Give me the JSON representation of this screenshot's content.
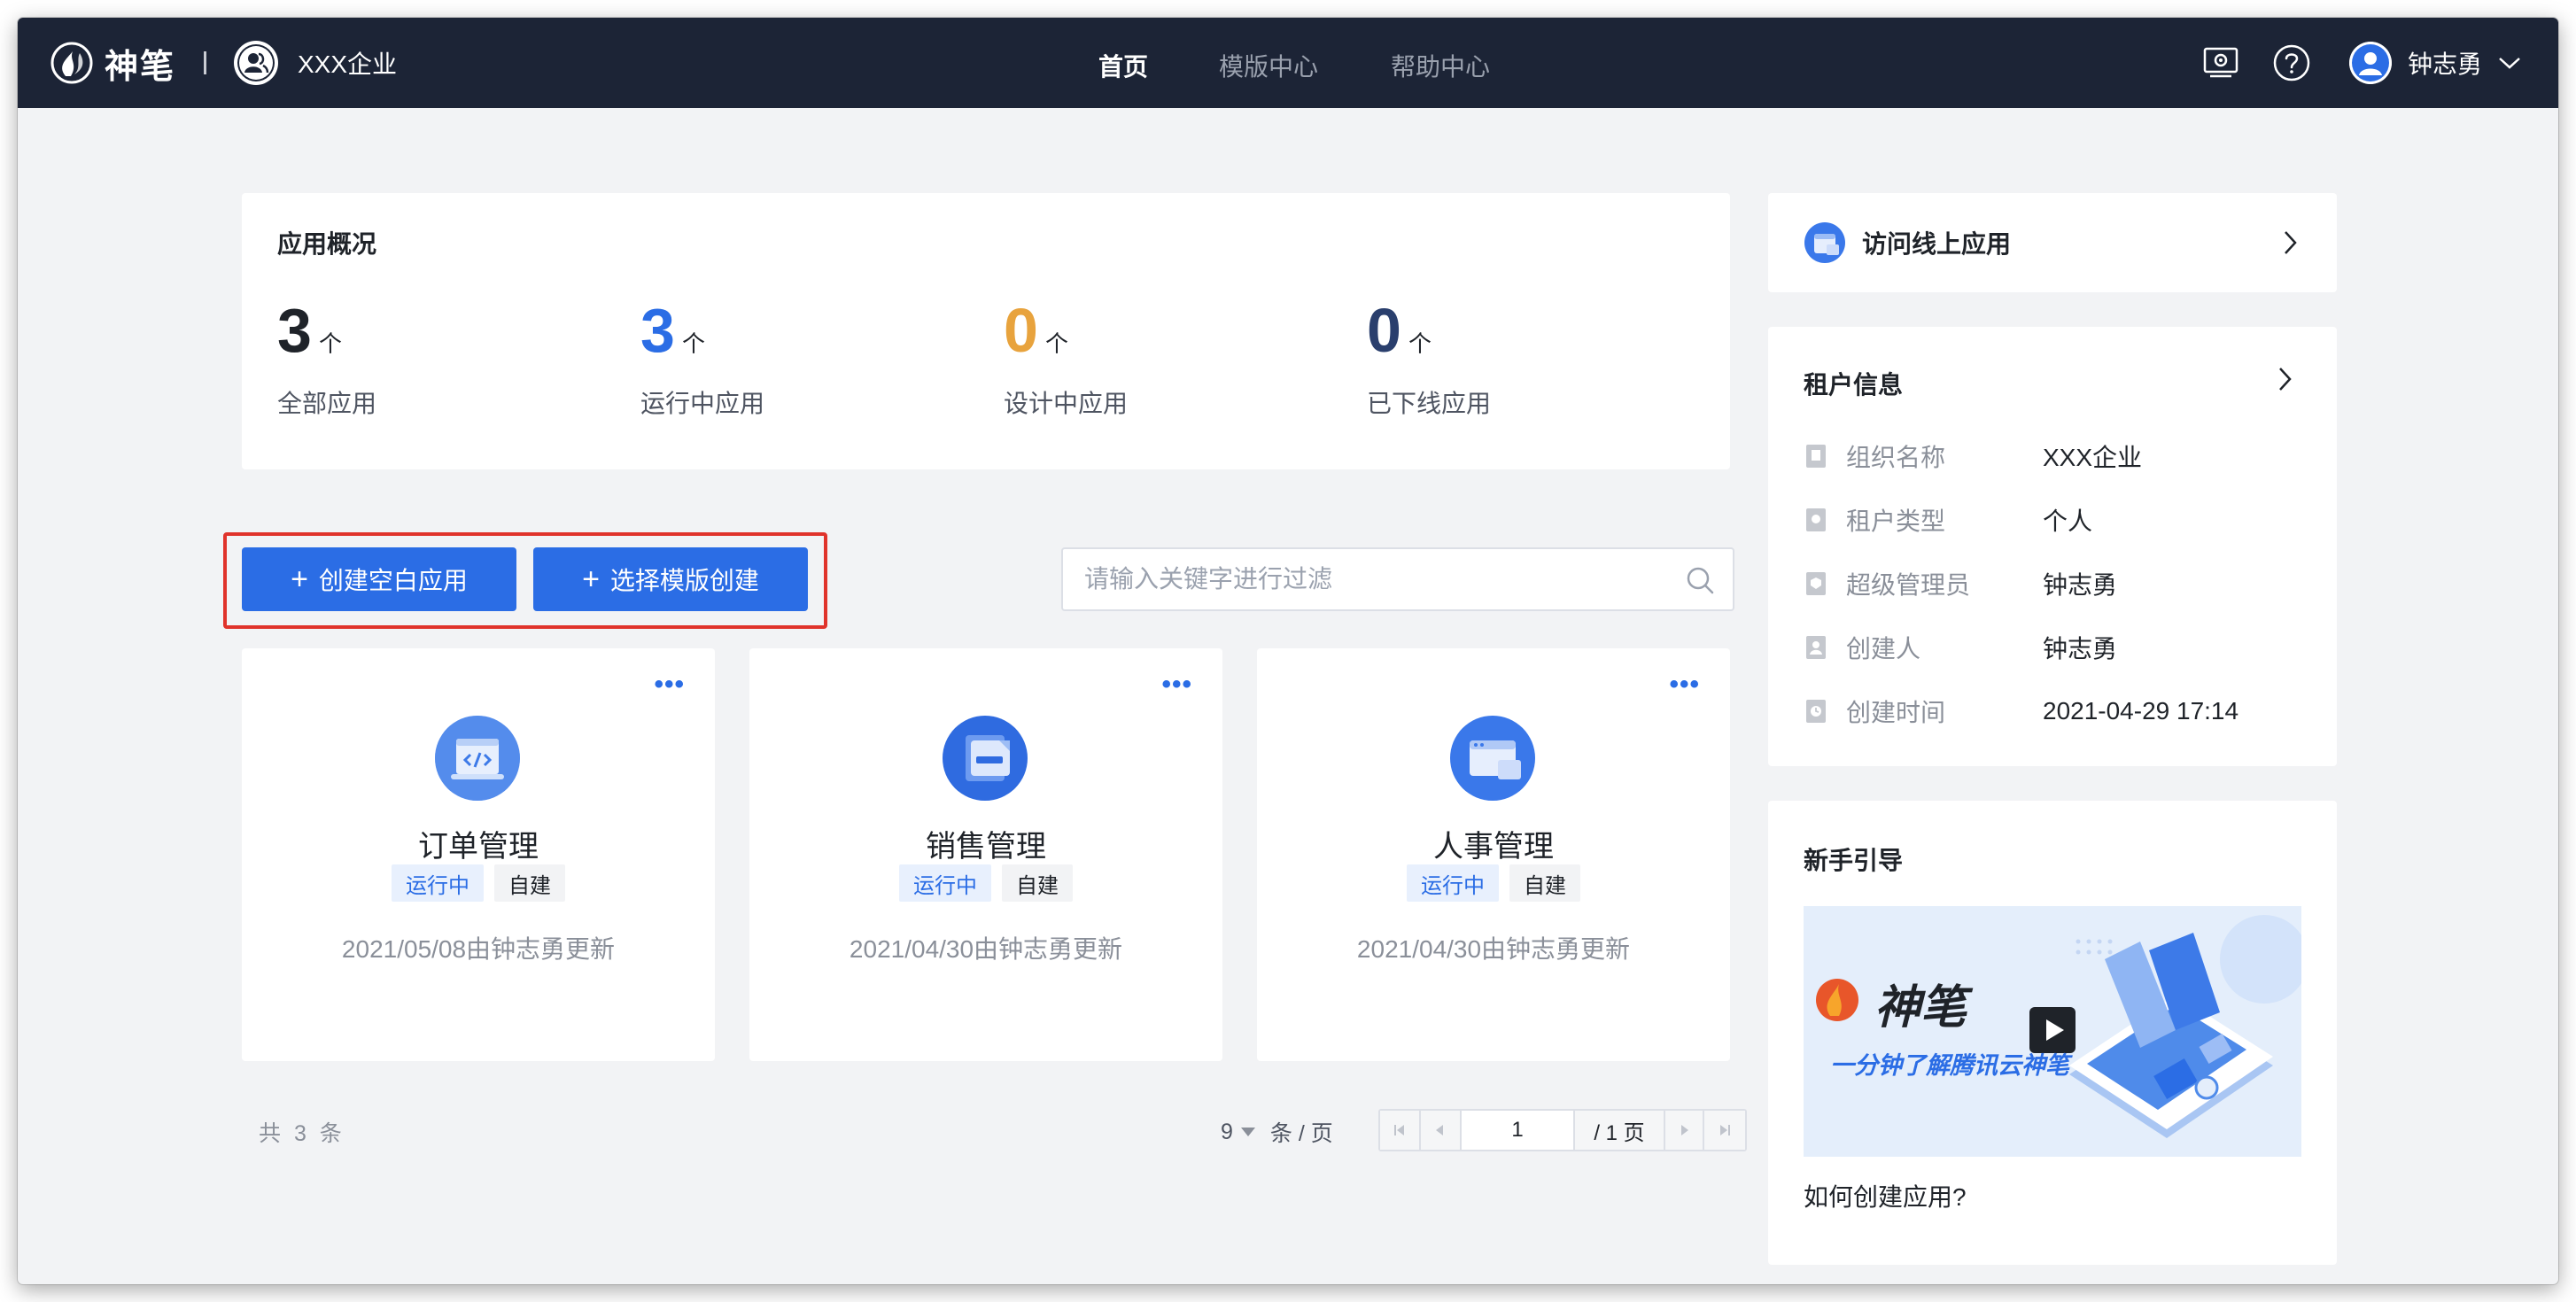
{
  "app": {
    "brand": "神笔",
    "org_name": "XXX企业"
  },
  "nav": {
    "items": [
      {
        "label": "首页",
        "active": true
      },
      {
        "label": "模版中心",
        "active": false
      },
      {
        "label": "帮助中心",
        "active": false
      }
    ]
  },
  "topbar": {
    "icons": [
      "screen-icon",
      "help-icon"
    ]
  },
  "user": {
    "name": "钟志勇"
  },
  "overview": {
    "title": "应用概况",
    "stats": [
      {
        "value": "3",
        "unit": "个",
        "label": "全部应用",
        "color": "#1f2329"
      },
      {
        "value": "3",
        "unit": "个",
        "label": "运行中应用",
        "color": "#2b6de5"
      },
      {
        "value": "0",
        "unit": "个",
        "label": "设计中应用",
        "color": "#e8a33d"
      },
      {
        "value": "0",
        "unit": "个",
        "label": "已下线应用",
        "color": "#2a3f6d"
      }
    ]
  },
  "actions": {
    "create_blank": "创建空白应用",
    "create_from_template": "选择模版创建",
    "search_placeholder": "请输入关键字进行过滤",
    "search_value": ""
  },
  "apps": [
    {
      "name": "订单管理",
      "status": "运行中",
      "source": "自建",
      "meta": "2021/05/08由钟志勇更新",
      "icon": "code-window-icon"
    },
    {
      "name": "销售管理",
      "status": "运行中",
      "source": "自建",
      "meta": "2021/04/30由钟志勇更新",
      "icon": "document-icon"
    },
    {
      "name": "人事管理",
      "status": "运行中",
      "source": "自建",
      "meta": "2021/04/30由钟志勇更新",
      "icon": "browser-window-icon"
    }
  ],
  "more_label": "•••",
  "pagination": {
    "total_text": "共 3 条",
    "page_size": "9",
    "page_size_unit": "条 / 页",
    "current_page": "1",
    "total_pages_text": "/ 1 页"
  },
  "visit": {
    "label": "访问线上应用"
  },
  "tenant": {
    "title": "租户信息",
    "rows": [
      {
        "label": "组织名称",
        "value": "XXX企业"
      },
      {
        "label": "租户类型",
        "value": "个人"
      },
      {
        "label": "超级管理员",
        "value": "钟志勇"
      },
      {
        "label": "创建人",
        "value": "钟志勇"
      },
      {
        "label": "创建时间",
        "value": "2021-04-29 17:14"
      }
    ]
  },
  "guide": {
    "title": "新手引导",
    "banner_brand": "神笔",
    "banner_text": "一分钟了解腾讯云神笔",
    "caption": "如何创建应用?"
  }
}
